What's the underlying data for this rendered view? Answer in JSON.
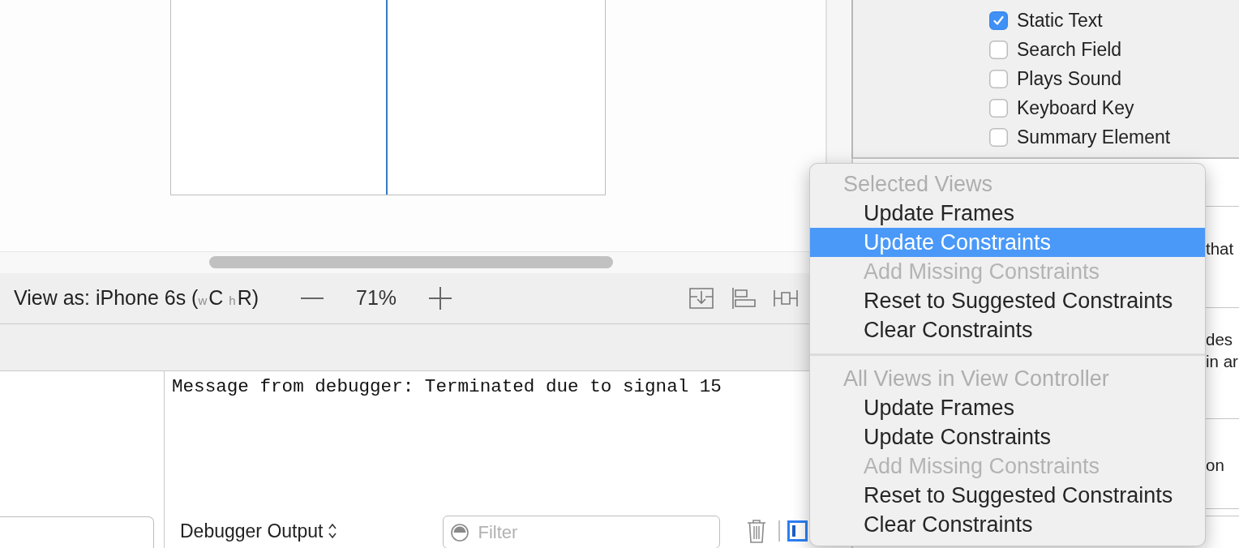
{
  "inspector": {
    "traits": [
      {
        "label": "Static Text",
        "checked": true
      },
      {
        "label": "Search Field",
        "checked": false
      },
      {
        "label": "Plays Sound",
        "checked": false
      },
      {
        "label": "Keyboard Key",
        "checked": false
      },
      {
        "label": "Summary Element",
        "checked": false
      }
    ],
    "sections": [
      {
        "lines": [
          "that"
        ]
      },
      {
        "lines": [
          "des",
          "in ar"
        ]
      },
      {
        "lines": [
          "on"
        ]
      }
    ]
  },
  "toolbar": {
    "view_as": "View as: iPhone 6s ($_{w}$C $_{h}$R)",
    "zoom": "71%"
  },
  "console": {
    "message": "Message from debugger: Terminated due to signal 15",
    "output_selector": "Debugger Output",
    "filter": {
      "placeholder": "Filter"
    }
  },
  "menu": {
    "sections": [
      {
        "header": "Selected Views",
        "items": [
          {
            "label": "Update Frames",
            "disabled": false,
            "selected": false
          },
          {
            "label": "Update Constraints",
            "disabled": false,
            "selected": true
          },
          {
            "label": "Add Missing Constraints",
            "disabled": true,
            "selected": false
          },
          {
            "label": "Reset to Suggested Constraints",
            "disabled": false,
            "selected": false
          },
          {
            "label": "Clear Constraints",
            "disabled": false,
            "selected": false
          }
        ]
      },
      {
        "header": "All Views in View Controller",
        "items": [
          {
            "label": "Update Frames",
            "disabled": false,
            "selected": false
          },
          {
            "label": "Update Constraints",
            "disabled": false,
            "selected": false
          },
          {
            "label": "Add Missing Constraints",
            "disabled": true,
            "selected": false
          },
          {
            "label": "Reset to Suggested Constraints",
            "disabled": false,
            "selected": false
          },
          {
            "label": "Clear Constraints",
            "disabled": false,
            "selected": false
          }
        ]
      }
    ]
  }
}
